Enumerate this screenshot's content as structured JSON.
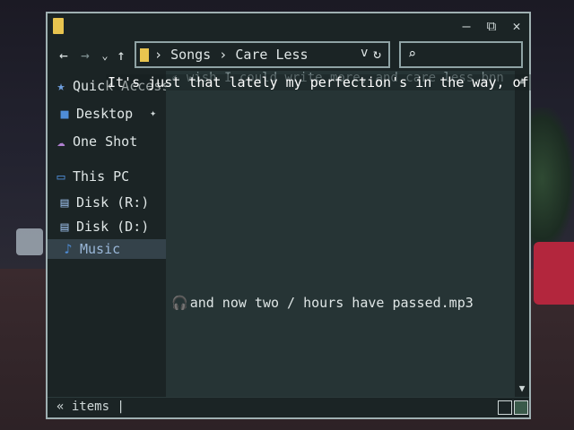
{
  "window": {
    "controls": {
      "minimize": "—",
      "restore": "⧉",
      "close": "✕"
    }
  },
  "nav": {
    "back": "←",
    "forward": "→",
    "recent": "⌄",
    "up": "↑"
  },
  "address": {
    "sep1": "›",
    "crumb1": "Songs",
    "sep2": "›",
    "crumb2": "Care Less",
    "chevron": "v",
    "refresh": "↻"
  },
  "search": {
    "icon": "⌕"
  },
  "sidebar": {
    "items": [
      {
        "label": "Quick Access",
        "icon": "★"
      },
      {
        "label": "Desktop",
        "icon": "■",
        "pin": "📌"
      },
      {
        "label": "One Shot",
        "icon": "☁"
      },
      {
        "label": "This PC",
        "icon": "▭"
      },
      {
        "label": "Disk (R:)",
        "icon": "▤"
      },
      {
        "label": "Disk (D:)",
        "icon": "▤"
      },
      {
        "label": "Music",
        "icon": "♪"
      }
    ]
  },
  "files": {
    "faded": "✍ wish I could write more, and care less.bnn",
    "main": "and now two / hours have passed.mp3",
    "main_icon": "🎧"
  },
  "scroll": {
    "up": "▲",
    "down": "▼"
  },
  "status": {
    "text": "« items |"
  },
  "lyric": "It's just that lately my perfection's in the way, of",
  "colors": {
    "window_bg": "#1b2425",
    "content_bg": "#263435",
    "folder": "#e8c44f",
    "selected": "#34424a",
    "accent": "#9ab7d8"
  }
}
